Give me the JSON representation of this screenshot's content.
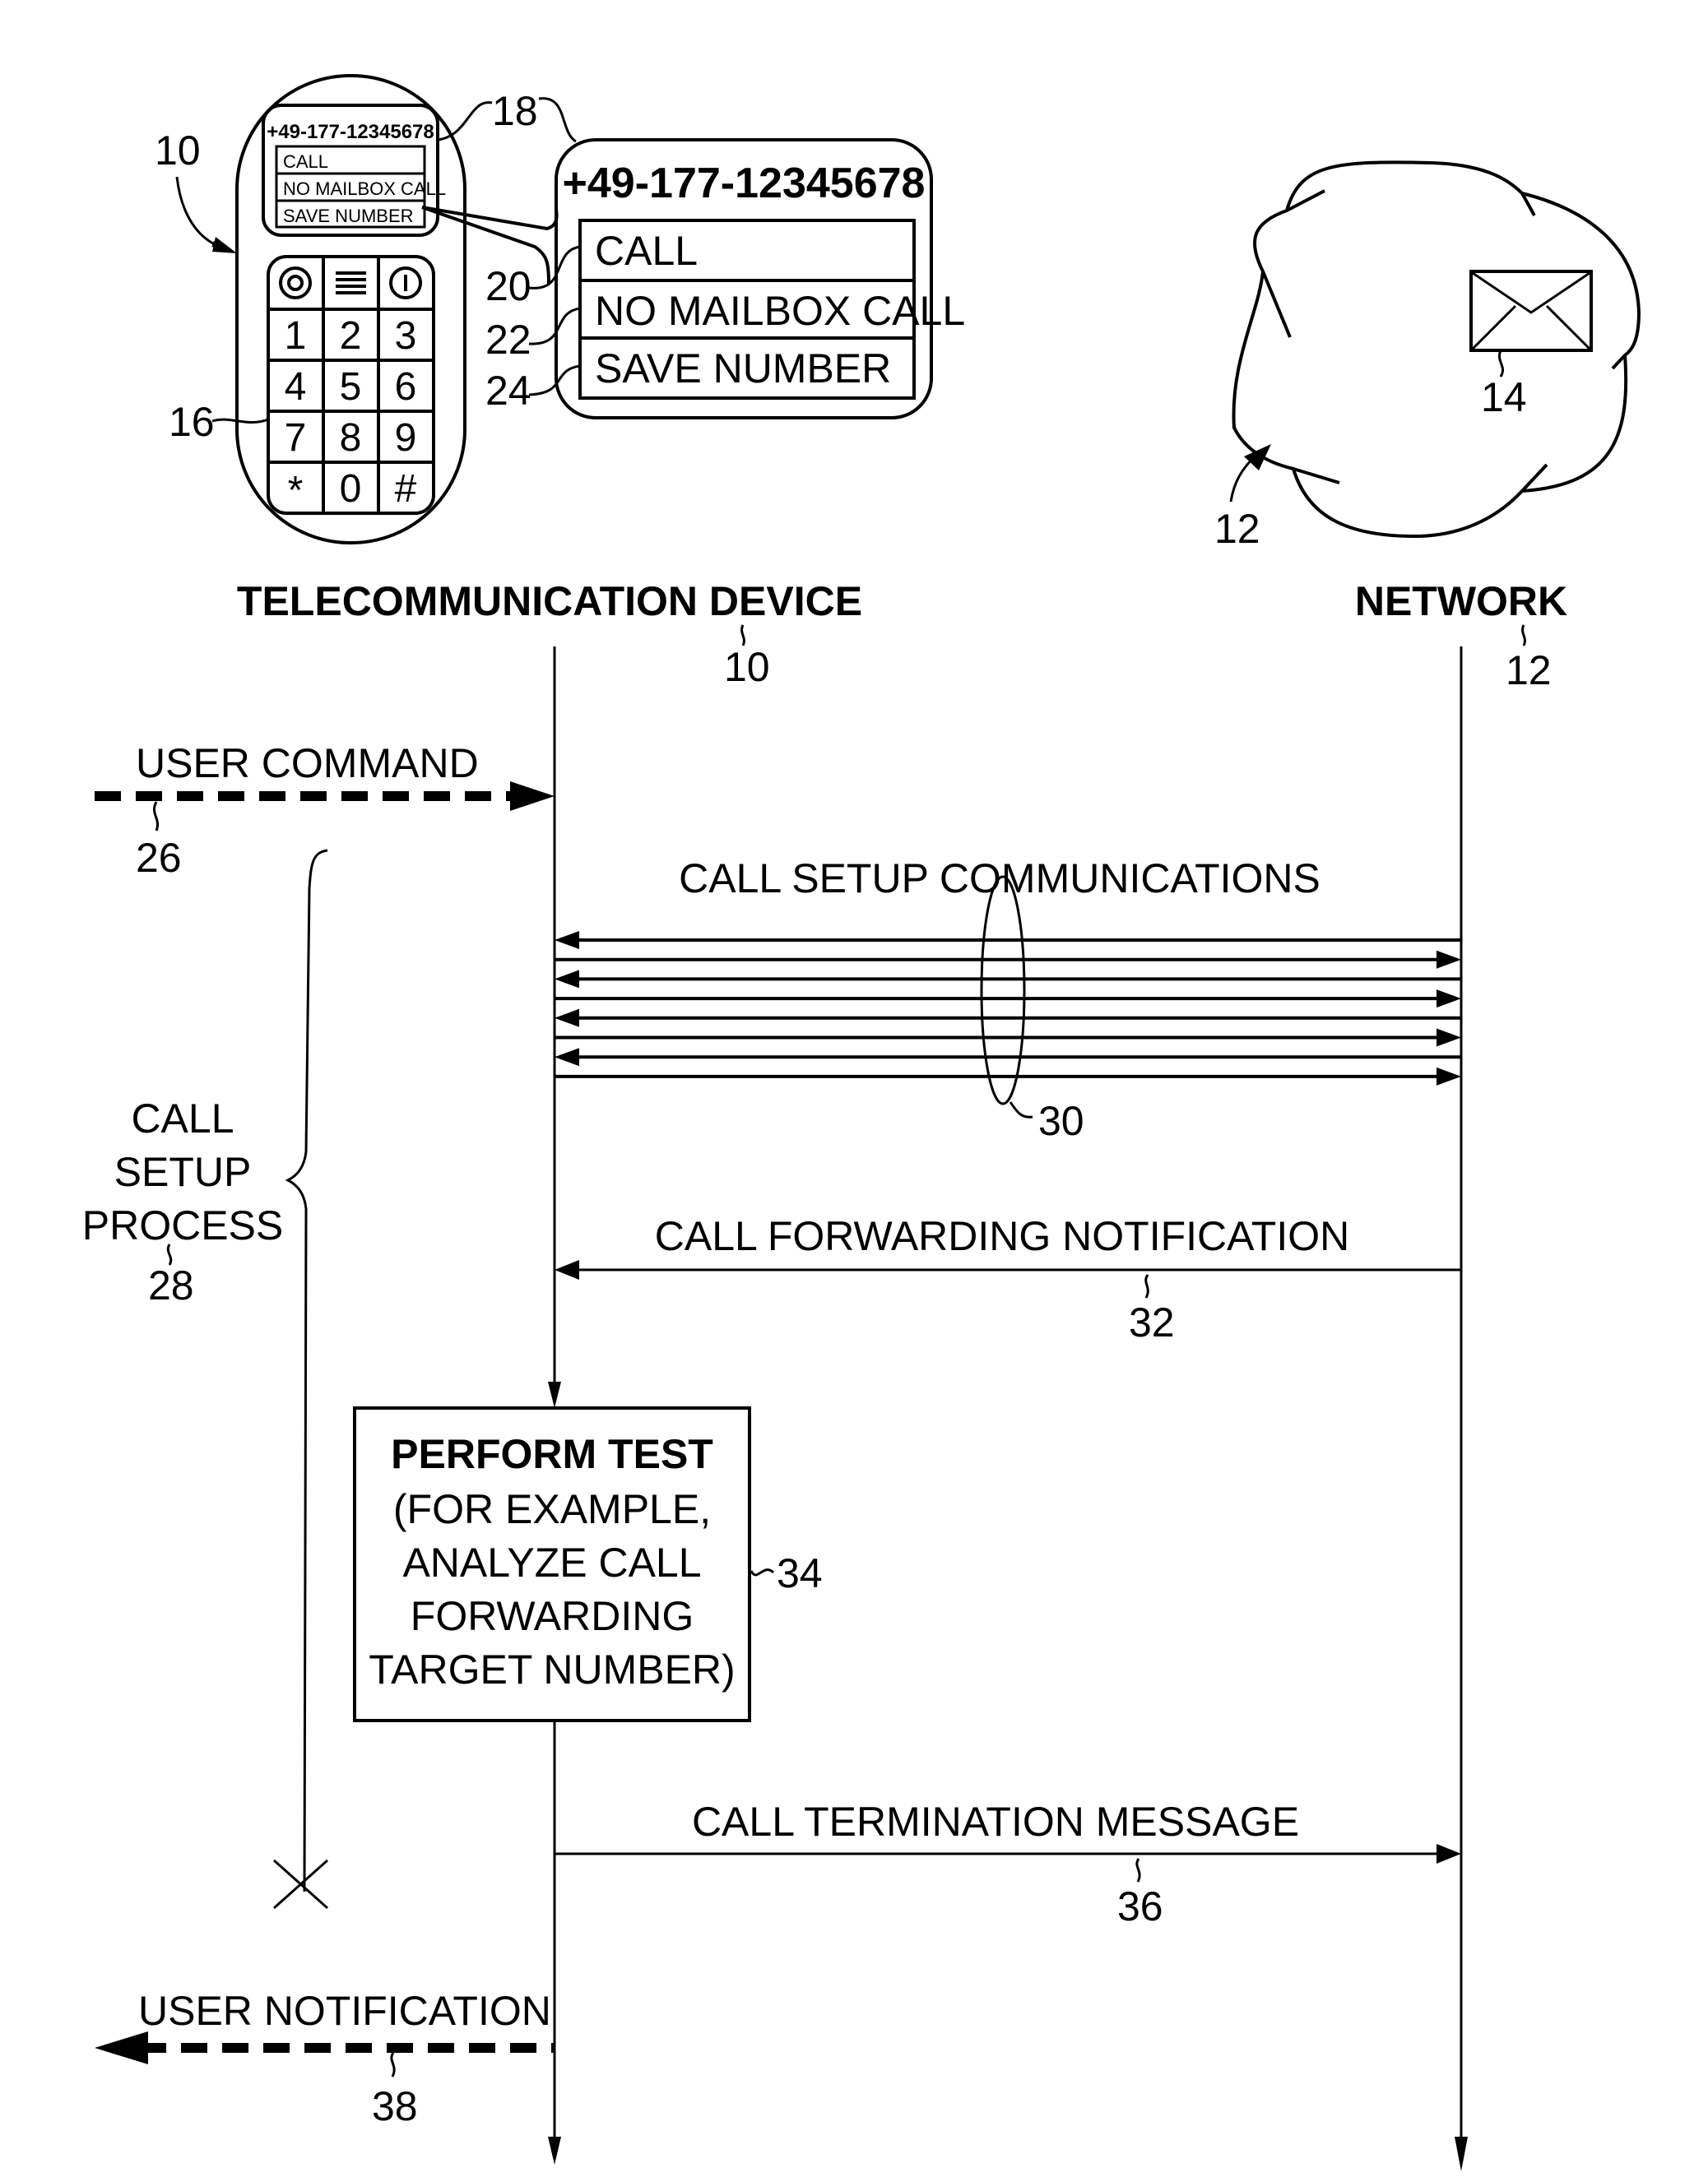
{
  "phone": {
    "ref": "10",
    "keypad_ref": "16",
    "screen_ref": "18",
    "screen_number": "+49-177-12345678",
    "menu": [
      "CALL",
      "NO MAILBOX CALL",
      "SAVE NUMBER"
    ],
    "keys": [
      "1",
      "2",
      "3",
      "4",
      "5",
      "6",
      "7",
      "8",
      "9",
      "*",
      "0",
      "#"
    ],
    "function_keys": [
      "target-icon",
      "menu-icon",
      "power-icon"
    ]
  },
  "callout": {
    "number": "+49-177-12345678",
    "items": [
      {
        "label": "CALL",
        "ref": "20"
      },
      {
        "label": "NO MAILBOX CALL",
        "ref": "22"
      },
      {
        "label": "SAVE NUMBER",
        "ref": "24"
      }
    ]
  },
  "network_cloud": {
    "ref": "12",
    "mailbox_ref": "14",
    "mailbox_icon": "envelope-icon"
  },
  "lifelines": {
    "device": {
      "label": "TELECOMMUNICATION DEVICE",
      "ref": "10"
    },
    "network": {
      "label": "NETWORK",
      "ref": "12"
    }
  },
  "messages": {
    "user_command": {
      "label": "USER COMMAND",
      "ref": "26"
    },
    "call_setup": {
      "label": "CALL SETUP COMMUNICATIONS",
      "ref": "30"
    },
    "call_forwarding": {
      "label": "CALL FORWARDING NOTIFICATION",
      "ref": "32"
    },
    "call_termination": {
      "label": "CALL TERMINATION MESSAGE",
      "ref": "36"
    },
    "user_notification": {
      "label": "USER NOTIFICATION",
      "ref": "38"
    }
  },
  "process": {
    "lines": [
      "CALL",
      "SETUP",
      "PROCESS"
    ],
    "ref": "28"
  },
  "test_box": {
    "title": "PERFORM TEST",
    "lines": [
      "(FOR EXAMPLE,",
      "ANALYZE CALL",
      "FORWARDING",
      "TARGET NUMBER)"
    ],
    "ref": "34"
  }
}
